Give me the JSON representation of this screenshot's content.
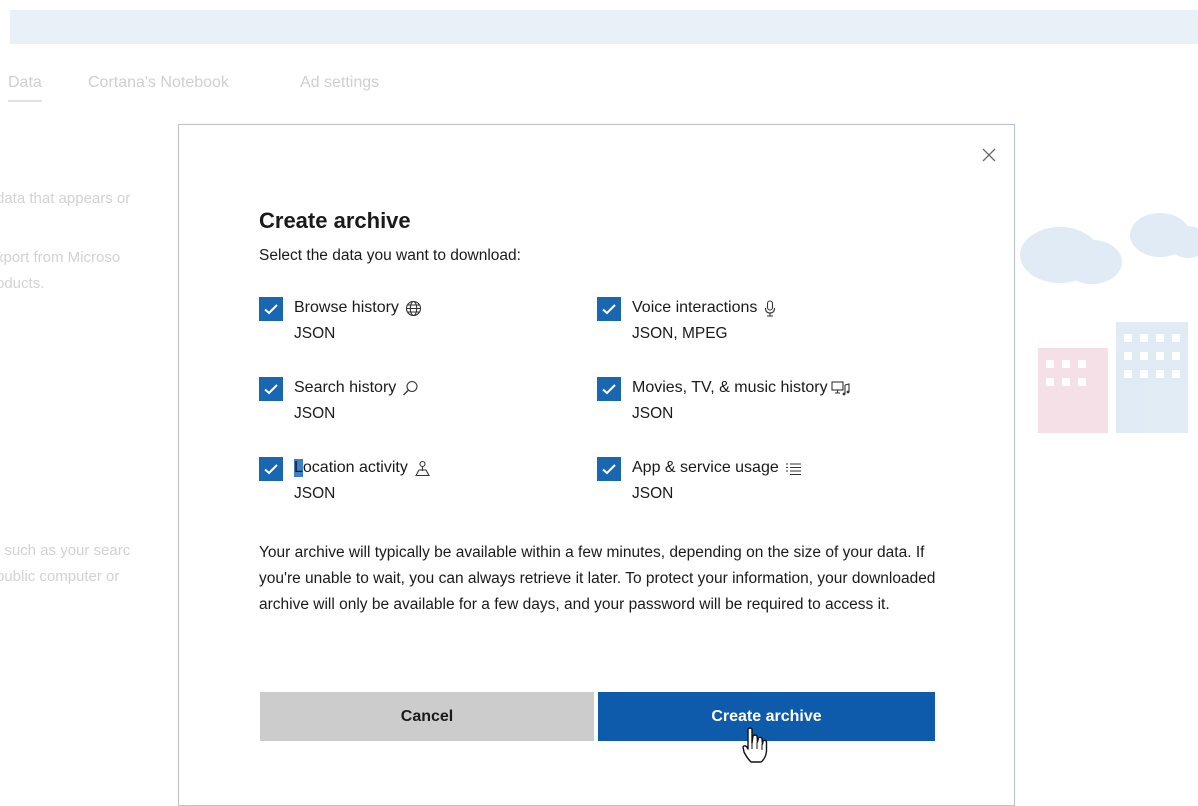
{
  "background": {
    "tabs": [
      {
        "label": "Data",
        "active": true
      },
      {
        "label": "Cortana's Notebook",
        "active": false
      },
      {
        "label": "Ad settings",
        "active": false
      }
    ],
    "text_lines": [
      "data that appears or",
      "xport from Microso",
      "oducts.",
      ", such as your searc",
      "public computer or"
    ]
  },
  "dialog": {
    "title": "Create archive",
    "subtitle": "Select the data you want to download:",
    "options": [
      {
        "label": "Browse history",
        "icon": "globe-icon",
        "format": "JSON",
        "checked": true
      },
      {
        "label": "Voice interactions",
        "icon": "microphone-icon",
        "format": "JSON, MPEG",
        "checked": true
      },
      {
        "label": "Search history",
        "icon": "search-icon",
        "format": "JSON",
        "checked": true
      },
      {
        "label": "Movies, TV, & music history",
        "icon": "media-icon",
        "format": "JSON",
        "checked": true
      },
      {
        "label_first": "L",
        "label_rest": "ocation activity",
        "icon": "location-icon",
        "format": "JSON",
        "checked": true
      },
      {
        "label": "App & service usage",
        "icon": "list-icon",
        "format": "JSON",
        "checked": true
      }
    ],
    "info_text": "Your archive will typically be available within a few minutes, depending on the size of your data. If you're unable to wait, you can always retrieve it later. To protect your information, your downloaded archive will only be available for a few days, and your password will be required to access it.",
    "cancel_label": "Cancel",
    "create_label": "Create archive"
  },
  "colors": {
    "accent": "#0e5bab",
    "checkbox": "#1a67b1",
    "cancel_bg": "#cccccc"
  }
}
